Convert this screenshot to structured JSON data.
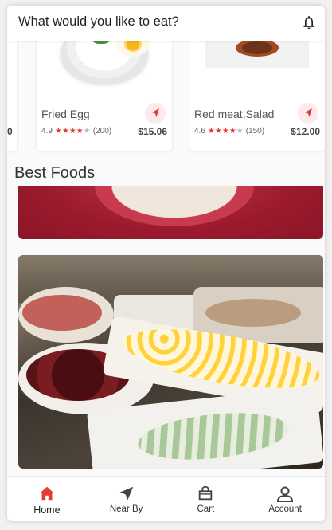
{
  "header": {
    "title": "What would you like to eat?",
    "icon": "bell-icon"
  },
  "popular": [
    {
      "name": "Fried Egg",
      "rating": "4.9",
      "stars": 4,
      "reviews": "(200)",
      "price": "$15.06"
    },
    {
      "name": "Red meat,Salad",
      "rating": "4.6",
      "stars": 4,
      "reviews": "(150)",
      "price": "$12.00"
    }
  ],
  "partial_card_price": "0",
  "section": {
    "title": "Best Foods"
  },
  "bottom_nav": {
    "items": [
      {
        "label": "Home",
        "icon": "home-icon",
        "active": true
      },
      {
        "label": "Near By",
        "icon": "navigation-icon",
        "active": false
      },
      {
        "label": "Cart",
        "icon": "cart-icon",
        "active": false
      },
      {
        "label": "Account",
        "icon": "account-icon",
        "active": false
      }
    ]
  },
  "colors": {
    "accent": "#e53935",
    "star": "#e53935",
    "nav_bg": "#fdeaea"
  }
}
